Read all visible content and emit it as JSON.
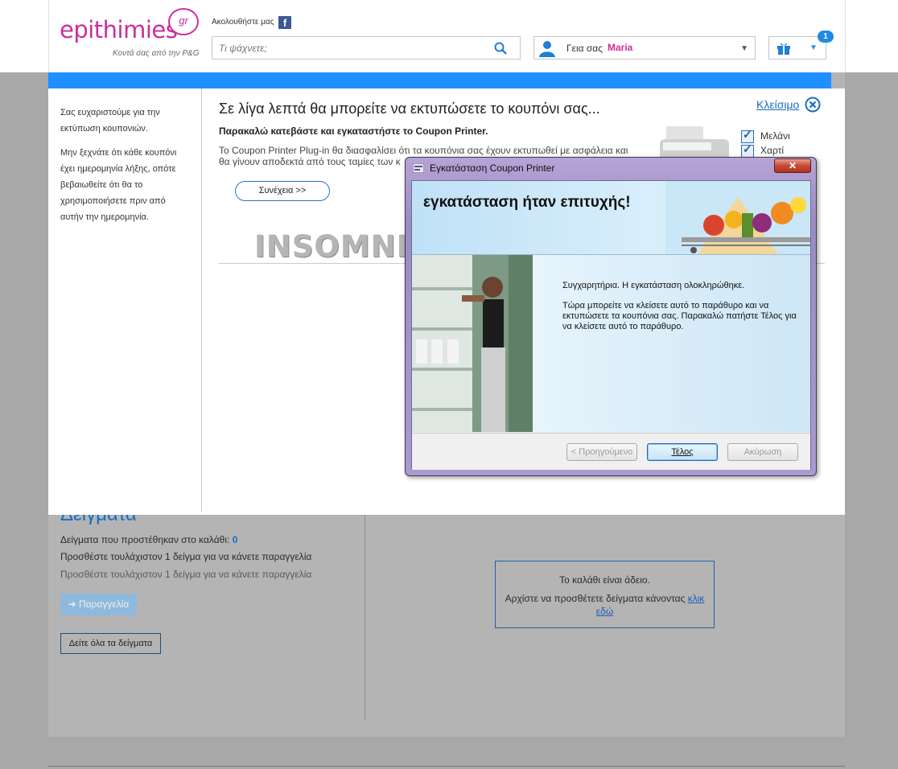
{
  "header": {
    "logo_text": "epithimies",
    "logo_suffix": "gr",
    "logo_tagline": "Κοντά σας από την P&G",
    "follow_label": "Ακολουθήστε μας",
    "facebook_icon": "facebook-icon",
    "search_placeholder": "Τι ψάχνετε;",
    "greeting": "Γεια σας",
    "user_name": "Maria",
    "gift_count": "1",
    "brand_color": "#cc2f98",
    "accent_color": "#1e90ff"
  },
  "background_page": {
    "samples_title": "Δείγματα",
    "samples_added_label": "Δείγματα που προστέθηκαν στο καλάθι:",
    "samples_added_count": "0",
    "hint_line_1": "Προσθέστε τουλάχιστον 1 δείγμα για να κάνετε παραγγελία",
    "hint_line_2": "Προσθέστε τουλάχιστον 1 δείγμα για να κάνετε παραγγελία",
    "order_button": "Παραγγελία",
    "all_samples_button": "Δείτε όλα τα δείγματα",
    "cart_empty": "Το καλάθι είναι άδειο.",
    "cart_start_text": "Αρχίστε να προσθέτετε δείγματα κάνοντας",
    "cart_link": "κλικ εδώ"
  },
  "modal": {
    "sidebar_text_1": "Σας ευχαριστούμε για την εκτύπωση κουπονιών.",
    "sidebar_text_2": "Μην ξεχνάτε ότι κάθε κουπόνι έχει ημερομηνία λήξης, οπότε βεβαιωθείτε ότι θα το χρησιμοποιήσετε πριν από αυτήν την ημερομηνία.",
    "title": "Σε λίγα λεπτά θα μπορείτε να εκτυπώσετε το κουπόνι σας...",
    "subtitle": "Παρακαλώ κατεβάστε και εγκαταστήστε το Coupon Printer.",
    "description": "Το Coupon Printer Plug-in θα διασφαλίσει ότι τα κουπόνια σας έχουν εκτυπωθεί με ασφάλεια και θα γίνουν αποδεκτά από τους ταμίες των κ",
    "continue_button": "Συνέχεια >>",
    "close_link": "Κλείσιμο",
    "checklist": [
      "Μελάνι",
      "Χαρτί"
    ],
    "sponsor_logo": "INSOMNIA"
  },
  "dialog": {
    "window_title": "Εγκατάσταση Coupon Printer",
    "banner_title": "εγκατάσταση ήταν επιτυχής!",
    "message_1": "Συγχαρητήρια. Η εγκατάσταση ολοκληρώθηκε.",
    "message_2": "Τώρα μπορείτε να κλείσετε αυτό το παράθυρο και να εκτυπώσετε τα κουπόνια σας. Παρακαλώ πατήστε Τέλος για να κλείσετε αυτό το παράθυρο.",
    "back_button": "< Προηγούμενο",
    "finish_button": "Τέλος",
    "cancel_button": "Ακύρωση"
  }
}
